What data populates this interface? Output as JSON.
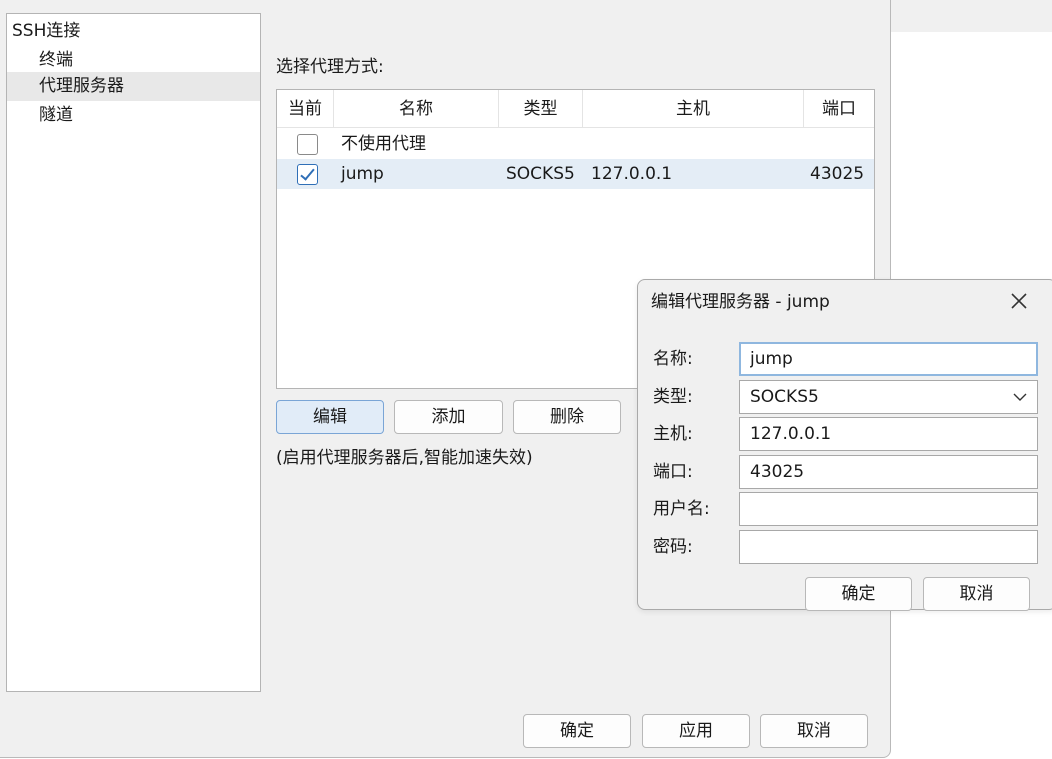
{
  "tree": {
    "root": "SSH连接",
    "items": [
      {
        "label": "终端",
        "selected": false
      },
      {
        "label": "代理服务器",
        "selected": true
      },
      {
        "label": "隧道",
        "selected": false
      }
    ]
  },
  "proxy": {
    "choose_label": "选择代理方式:",
    "columns": [
      "当前",
      "名称",
      "类型",
      "主机",
      "端口"
    ],
    "rows": [
      {
        "checked": false,
        "name": "不使用代理",
        "type": "",
        "host": "",
        "port": ""
      },
      {
        "checked": true,
        "name": "jump",
        "type": "SOCKS5",
        "host": "127.0.0.1",
        "port": "43025"
      }
    ],
    "edit_label": "编辑",
    "add_label": "添加",
    "delete_label": "删除",
    "note": "(启用代理服务器后,智能加速失效)"
  },
  "footer": {
    "ok_label": "确定",
    "apply_label": "应用",
    "cancel_label": "取消"
  },
  "edit_dialog": {
    "title": "编辑代理服务器 - jump",
    "name_label": "名称:",
    "name_value": "jump",
    "type_label": "类型:",
    "type_value": "SOCKS5",
    "host_label": "主机:",
    "host_value": "127.0.0.1",
    "port_label": "端口:",
    "port_value": "43025",
    "user_label": "用户名:",
    "user_value": "",
    "password_label": "密码:",
    "password_value": "",
    "ok_label": "确定",
    "cancel_label": "取消"
  },
  "colors": {
    "selection_row": "#e4edf6",
    "checkbox_accent": "#2f6fb7",
    "focus_border": "#8fb7df"
  }
}
